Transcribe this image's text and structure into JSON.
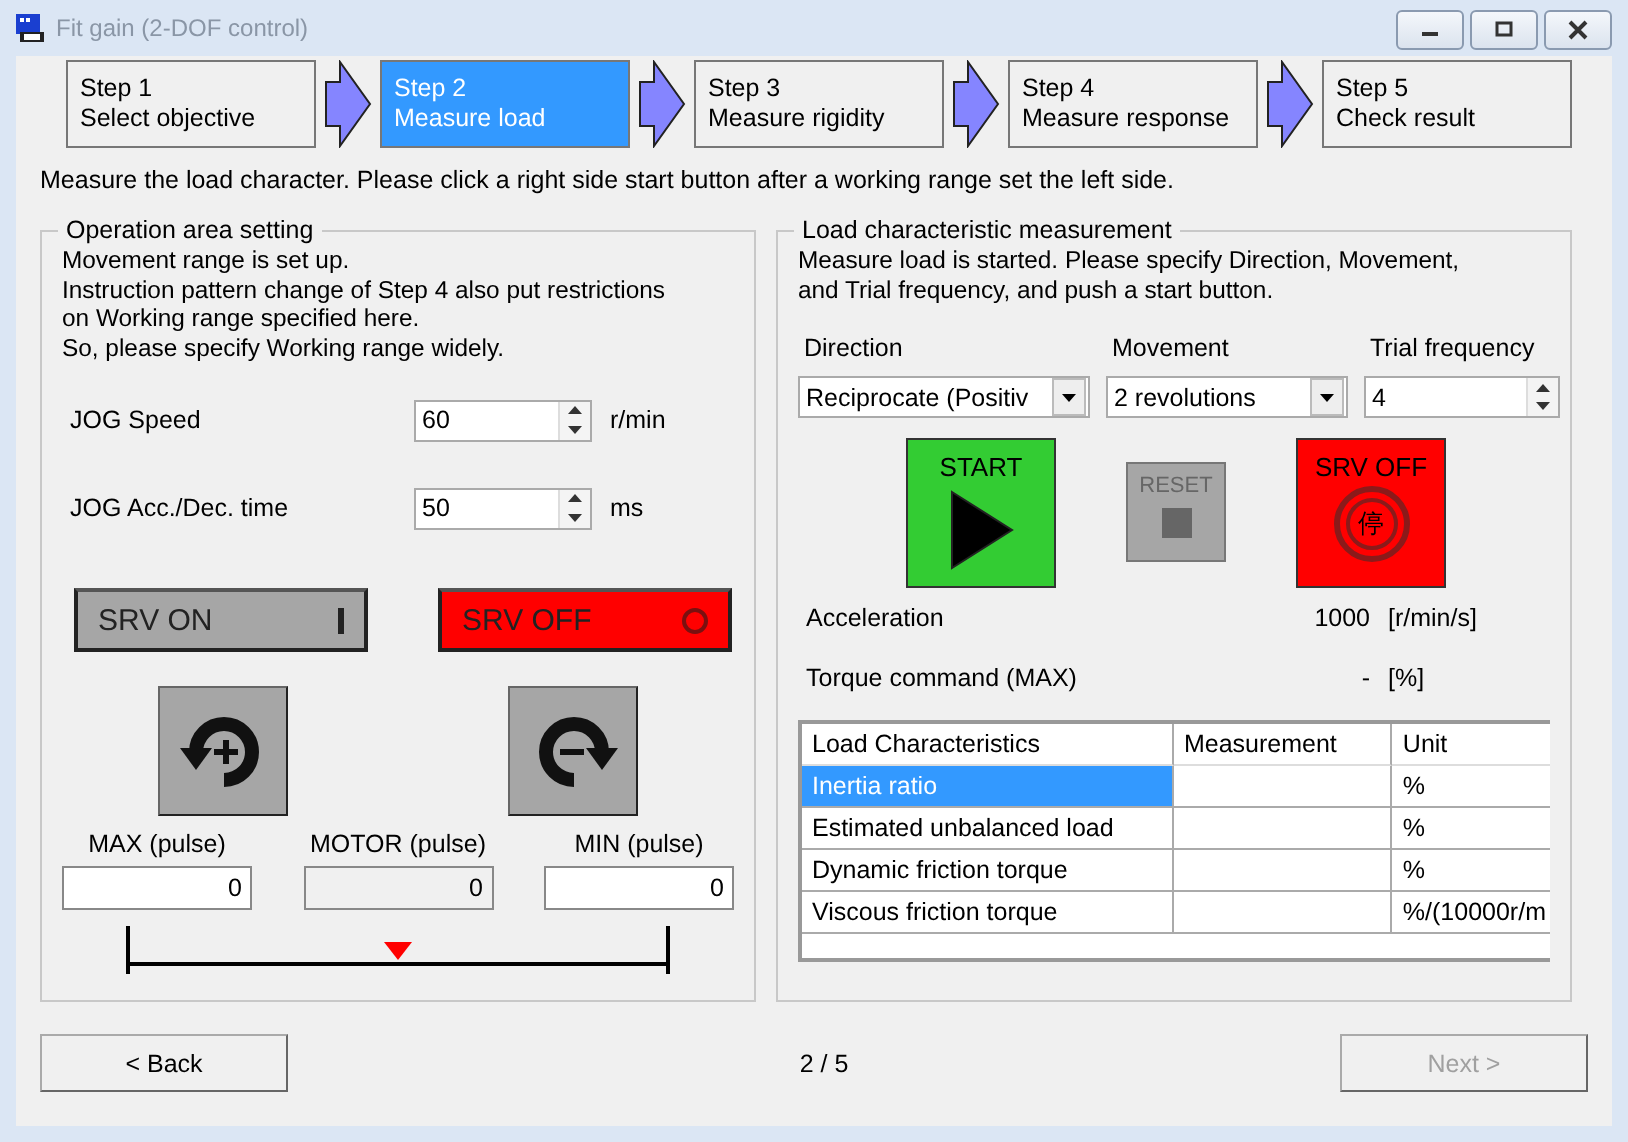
{
  "window": {
    "title": "Fit gain (2-DOF control)"
  },
  "steps": [
    {
      "number": "Step 1",
      "label": "Select objective",
      "selected": false
    },
    {
      "number": "Step 2",
      "label": "Measure load",
      "selected": true
    },
    {
      "number": "Step 3",
      "label": "Measure rigidity",
      "selected": false
    },
    {
      "number": "Step 4",
      "label": "Measure response",
      "selected": false
    },
    {
      "number": "Step 5",
      "label": "Check result",
      "selected": false
    }
  ],
  "instruction": "Measure the load character. Please click a right side start button after a working range set the left side.",
  "operation_area": {
    "title": "Operation area setting",
    "description_lines": [
      "Movement range is set up.",
      "Instruction pattern change of Step 4 also put restrictions",
      "on Working range specified here.",
      "So, please specify Working range widely."
    ],
    "settings": [
      {
        "label": "JOG Speed",
        "value": "60",
        "unit": "r/min"
      },
      {
        "label": "JOG Acc./Dec. time",
        "value": "50",
        "unit": "ms"
      }
    ],
    "srv_on": {
      "label": "SRV ON",
      "on": false
    },
    "srv_off": {
      "label": "SRV OFF",
      "on": true
    },
    "positions": [
      {
        "label": "MAX (pulse)",
        "value": "0",
        "disabled": false
      },
      {
        "label": "MOTOR (pulse)",
        "value": "0",
        "disabled": true
      },
      {
        "label": "MIN (pulse)",
        "value": "0",
        "disabled": false
      }
    ],
    "motor_marker": {
      "level": 0.5
    }
  },
  "load_measurement": {
    "title": "Load characteristic measurement",
    "description_lines": [
      "Measure load is started. Please specify Direction, Movement,",
      "and Trial frequency, and push a start button."
    ],
    "direction": {
      "label": "Direction",
      "value": "Reciprocate (Positiv"
    },
    "movement": {
      "label": "Movement",
      "value": "2 revolutions"
    },
    "trial_frequency": {
      "label": "Trial frequency",
      "value": "4"
    },
    "start": {
      "label": "START",
      "disabled": false
    },
    "reset": {
      "label": "RESET",
      "disabled": true
    },
    "srv_off": {
      "label": "SRV OFF",
      "glyph": "停"
    },
    "readings": [
      {
        "label": "Acceleration",
        "value": "1000",
        "unit": "[r/min/s]"
      },
      {
        "label": "Torque command (MAX)",
        "value": "-",
        "unit": "[%]"
      }
    ],
    "table": {
      "columns": [
        "Load Characteristics",
        "Measurement",
        "Unit"
      ],
      "rows": [
        {
          "name": "Inertia ratio",
          "measurement": "",
          "unit": "%",
          "selected": true
        },
        {
          "name": "Estimated unbalanced load",
          "measurement": "",
          "unit": "%",
          "selected": false
        },
        {
          "name": "Dynamic friction torque",
          "measurement": "",
          "unit": "%",
          "selected": false
        },
        {
          "name": "Viscous friction torque",
          "measurement": "",
          "unit": "%/(10000r/m",
          "selected": false
        }
      ]
    }
  },
  "footer": {
    "back": {
      "label": "< Back",
      "disabled": false
    },
    "page": "2 / 5",
    "next": {
      "label": "Next >",
      "disabled": true
    }
  }
}
